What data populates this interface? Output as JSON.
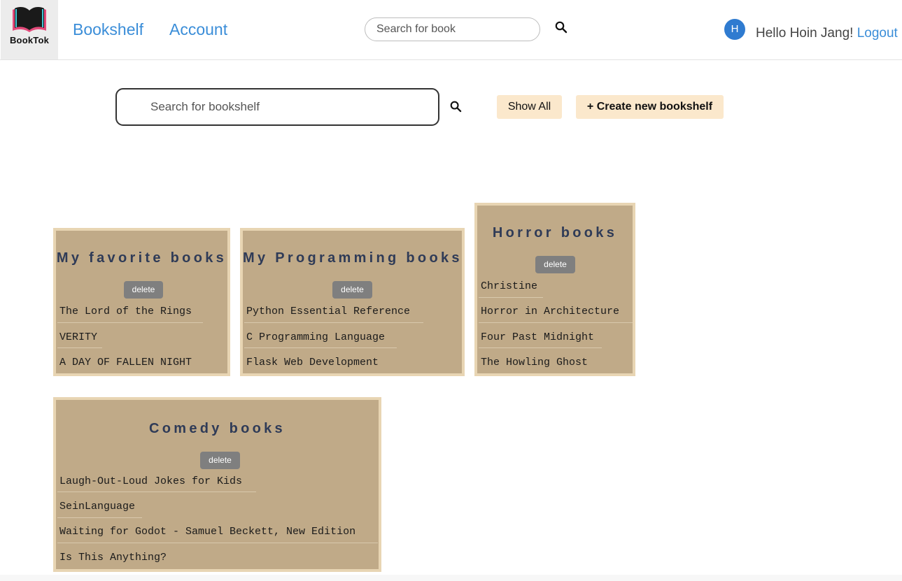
{
  "header": {
    "logo_text": "BookTok",
    "nav": {
      "bookshelf": "Bookshelf",
      "account": "Account"
    },
    "book_search_placeholder": "Search for book",
    "avatar_initial": "H",
    "greeting": "Hello Hoin Jang! ",
    "logout": "Logout"
  },
  "toolbar": {
    "shelf_search_placeholder": "Search for bookshelf",
    "show_all": "Show All",
    "create": "+ Create new bookshelf"
  },
  "shelves": [
    {
      "title": "My favorite books",
      "delete_label": "delete",
      "books": [
        "The Lord of the Rings",
        "VERITY",
        "A DAY OF FALLEN NIGHT"
      ]
    },
    {
      "title": "My Programming books",
      "delete_label": "delete",
      "books": [
        "Python Essential Reference",
        "C Programming Language",
        "Flask Web Development"
      ]
    },
    {
      "title": "Horror books",
      "delete_label": "delete",
      "books": [
        "Christine",
        "Horror in Architecture",
        "Four Past Midnight",
        "The Howling Ghost"
      ]
    },
    {
      "title": "Comedy books",
      "delete_label": "delete",
      "books": [
        "Laugh-Out-Loud Jokes for Kids",
        "SeinLanguage",
        "Waiting for Godot - Samuel Beckett, New Edition",
        "Is This Anything?"
      ]
    }
  ],
  "colors": {
    "link": "#3a8dd8",
    "shelf_bg": "#c0aa88",
    "shelf_border": "#e8d5b3",
    "shelf_title": "#2f3b57",
    "button_bg": "#fbe8cc",
    "delete_bg": "#7f7f7f",
    "avatar_bg": "#2f7bd0"
  }
}
